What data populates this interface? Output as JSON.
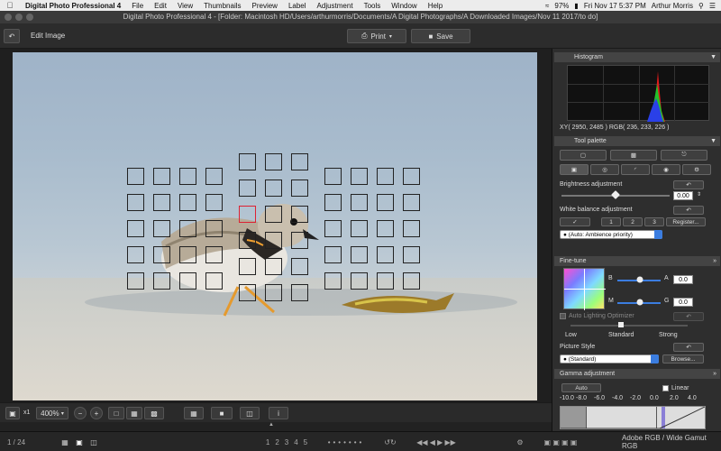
{
  "menubar": {
    "app": "Digital Photo Professional 4",
    "items": [
      "File",
      "Edit",
      "View",
      "Thumbnails",
      "Preview",
      "Label",
      "Adjustment",
      "Tools",
      "Window",
      "Help"
    ],
    "battery": "97%",
    "datetime": "Fri Nov 17  5:37 PM",
    "user": "Arthur Morris"
  },
  "window": {
    "title": "Digital Photo Professional 4 - [Folder: Macintosh HD/Users/arthurmorris/Documents/A Digital Photographs/A Downloaded Images/Nov 11 2017/to do]"
  },
  "toolbar": {
    "mode_label": "Edit Image",
    "print_label": "Print",
    "save_label": "Save"
  },
  "viewer_bar": {
    "zoom_prefix": "x1",
    "zoom_value": "400%"
  },
  "status": {
    "page": "1 / 24",
    "profile": "Adobe RGB / Wide Gamut RGB",
    "ratings": [
      "1",
      "2",
      "3",
      "4",
      "5"
    ]
  },
  "histogram": {
    "title": "Histogram",
    "readout": "XY(  2950,   2485 ) RGB( 236, 233, 226 )"
  },
  "tool_palette": {
    "title": "Tool palette",
    "brightness_label": "Brightness adjustment",
    "brightness_value": "0.00",
    "brightness_level": 0.5,
    "wb_label": "White balance adjustment",
    "wb_presets": [
      "1",
      "2",
      "3"
    ],
    "register_label": "Register...",
    "wb_select": "(Auto: Ambience priority)"
  },
  "fine_tune": {
    "title": "Fine-tune",
    "b_label": "B",
    "a_label": "A",
    "m_label": "M",
    "g_label": "G",
    "a_value": "0.0",
    "g_value": "0.0",
    "alo_label": "Auto Lighting Optimizer",
    "alo_levels": [
      "Low",
      "Standard",
      "Strong"
    ],
    "picture_style_label": "Picture Style",
    "picture_style_value": "(Standard)",
    "browse_label": "Browse..."
  },
  "gamma": {
    "title": "Gamma adjustment",
    "auto_label": "Auto",
    "linear_label": "Linear",
    "scale": [
      "-10.0",
      "-8.0",
      "-6.0",
      "-4.0",
      "-2.0",
      "0.0",
      "2.0",
      "4.0"
    ]
  },
  "colors": {
    "accent": "#3b7de0",
    "af_selected": "#dd2233"
  }
}
